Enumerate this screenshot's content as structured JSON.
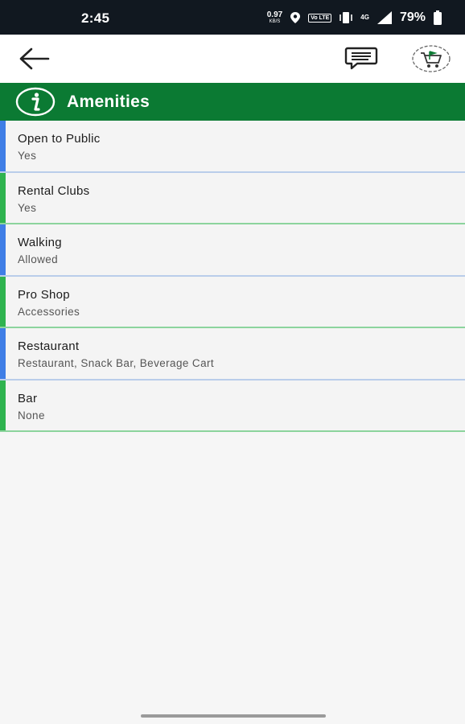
{
  "status_bar": {
    "time": "2:45",
    "net_speed_value": "0.97",
    "net_speed_unit": "KB/S",
    "volte": "Vo LTE",
    "network": "4G",
    "battery_percent": "79%",
    "icons": [
      "location-icon",
      "vibrate-icon",
      "signal-icon",
      "battery-icon"
    ]
  },
  "app_bar": {
    "icons": [
      "back-arrow-icon",
      "chat-icon",
      "app-logo-icon"
    ]
  },
  "section": {
    "title": "Amenities",
    "icon": "info-icon",
    "color": "#0b7a33"
  },
  "amenities": [
    {
      "label": "Open to Public",
      "value": "Yes",
      "accent": "#3f7ee6"
    },
    {
      "label": "Rental Clubs",
      "value": "Yes",
      "accent": "#2fb34f"
    },
    {
      "label": "Walking",
      "value": "Allowed",
      "accent": "#3f7ee6"
    },
    {
      "label": "Pro Shop",
      "value": "Accessories",
      "accent": "#2fb34f"
    },
    {
      "label": "Restaurant",
      "value": "Restaurant, Snack Bar, Beverage Cart",
      "accent": "#3f7ee6"
    },
    {
      "label": "Bar",
      "value": "None",
      "accent": "#2fb34f"
    }
  ]
}
